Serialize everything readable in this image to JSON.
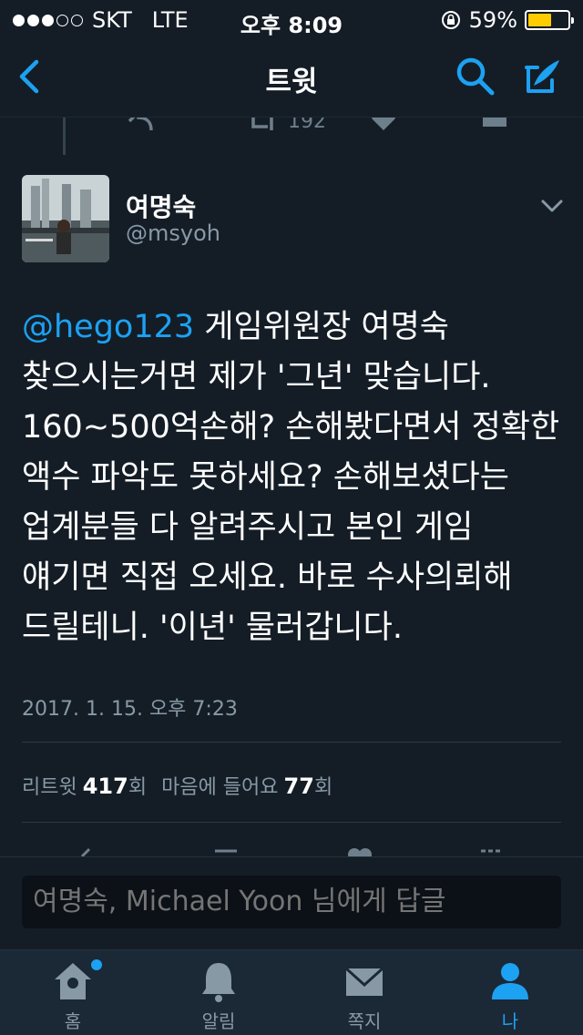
{
  "status_bar": {
    "carrier": "SKT",
    "network": "LTE",
    "time": "오후 8:09",
    "battery": "59%",
    "battery_level": 0.59,
    "battery_color": "#ffcc00"
  },
  "nav": {
    "title": "트윗",
    "back_icon": "chevron-left-icon",
    "search_icon": "search-icon",
    "compose_icon": "compose-tweet-icon",
    "accent": "#1da1f2"
  },
  "previous_tweet": {
    "retweet_count": "192"
  },
  "tweet": {
    "author_name": "여명숙",
    "author_handle": "@msyoh",
    "mention": "@hego123",
    "text": " 게임위원장 여명숙 찾으시는거면 제가 '그년' 맞습니다. 160~500억손해? 손해봤다면서 정확한 액수 파악도 못하세요? 손해보셨다는 업계분들 다 알려주시고 본인 게임 얘기면 직접 오세요. 바로 수사의뢰해 드릴테니. '이년' 물러갑니다.",
    "timestamp": "2017. 1. 15. 오후 7:23",
    "retweet_label": "리트윗",
    "retweet_count": "417",
    "retweet_unit": "회",
    "like_label": "마음에 들어요",
    "like_count": "77",
    "like_unit": "회"
  },
  "reply": {
    "placeholder": "여명숙, Michael Yoon 님에게 답글"
  },
  "tabbar": {
    "tabs": [
      {
        "label": "홈",
        "icon": "home-icon",
        "has_badge": true
      },
      {
        "label": "알림",
        "icon": "bell-icon"
      },
      {
        "label": "쪽지",
        "icon": "envelope-icon"
      },
      {
        "label": "나",
        "icon": "person-icon",
        "active": true
      }
    ]
  }
}
